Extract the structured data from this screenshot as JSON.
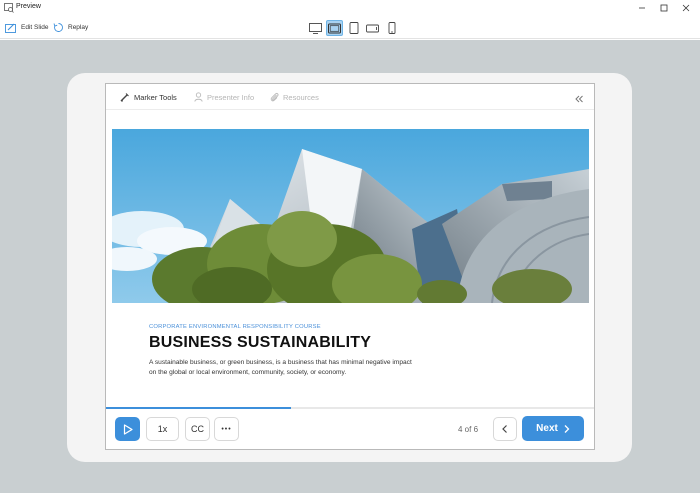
{
  "window": {
    "title": "Preview",
    "icon": "preview-window-icon"
  },
  "toolbar": {
    "edit_slide_label": "Edit Slide",
    "replay_label": "Replay",
    "devices": [
      {
        "name": "desktop",
        "icon": "desktop-icon",
        "active": false
      },
      {
        "name": "tablet-landscape",
        "icon": "tablet-landscape-icon",
        "active": true
      },
      {
        "name": "tablet-portrait",
        "icon": "tablet-portrait-icon",
        "active": false
      },
      {
        "name": "phone-landscape",
        "icon": "phone-landscape-icon",
        "active": false
      },
      {
        "name": "phone-portrait",
        "icon": "phone-portrait-icon",
        "active": false
      }
    ]
  },
  "player": {
    "tabs": [
      {
        "label": "Marker Tools",
        "icon": "marker-icon",
        "enabled": true
      },
      {
        "label": "Presenter Info",
        "icon": "person-icon",
        "enabled": false
      },
      {
        "label": "Resources",
        "icon": "paperclip-icon",
        "enabled": false
      }
    ],
    "collapse_icon": "double-chevron-left-icon"
  },
  "slide": {
    "kicker": "CORPORATE ENVIRONMENTAL RESPONSIBILITY COURSE",
    "title": "BUSINESS SUSTAINABILITY",
    "description": "A sustainable business, or green business, is a business that has minimal negative impact on the global or local environment, community, society, or economy."
  },
  "controls": {
    "speed_label": "1x",
    "cc_label": "CC",
    "more_label": "•••",
    "page_count": "4 of 6",
    "next_label": "Next",
    "progress_percent": 38
  },
  "colors": {
    "accent": "#3c8fdb",
    "stage_bg": "#c9cfd1",
    "tablet_bezel": "#f4f4f4",
    "kicker": "#4a90d9"
  }
}
